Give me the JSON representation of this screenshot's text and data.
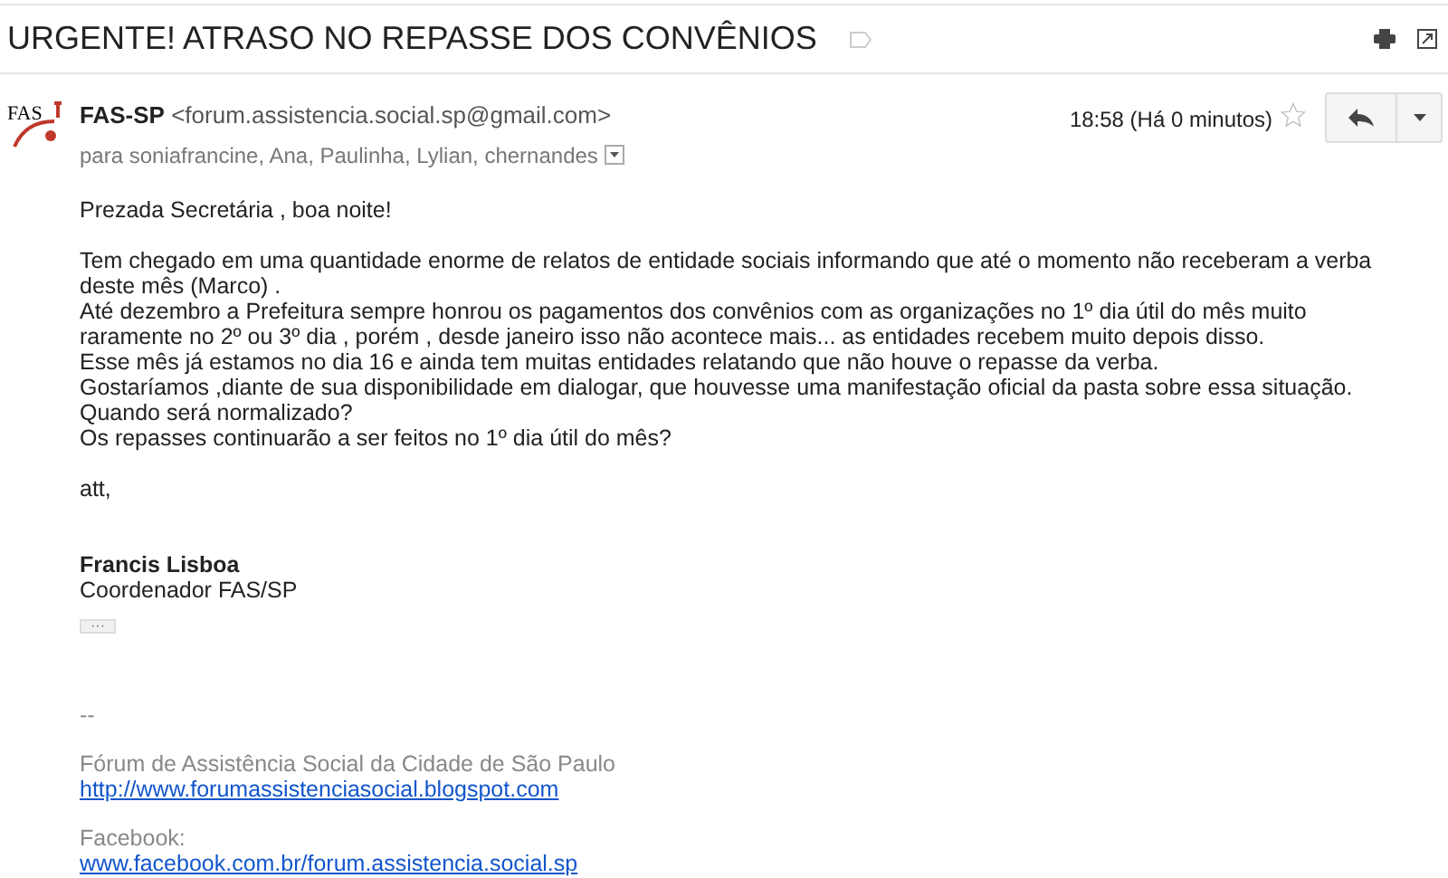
{
  "subject": "URGENTE! ATRASO NO REPASSE DOS CONVÊNIOS",
  "sender": {
    "name": "FAS-SP",
    "email": "<forum.assistencia.social.sp@gmail.com>",
    "avatar_text": "FAS",
    "recipients": "para soniafrancine, Ana, Paulinha, Lylian, chernandes",
    "time": "18:58 (Há 0 minutos)",
    "starred": false
  },
  "body": [
    [
      "Prezada Secretária , boa noite!"
    ],
    [
      "Tem chegado em uma quantidade enorme de relatos de entidade sociais informando que até o momento não receberam a verba deste mês (Marco) .",
      "Até dezembro a Prefeitura sempre honrou os pagamentos dos convênios com as organizações no 1º dia útil do mês muito raramente no 2º ou 3º dia , porém , desde janeiro isso não acontece mais... as entidades recebem muito depois disso.",
      "Esse mês já estamos no dia 16 e ainda tem muitas entidades relatando que não houve o repasse da verba.",
      "Gostaríamos ,diante de sua disponibilidade em dialogar, que houvesse uma manifestação oficial da pasta sobre essa situação.",
      "Quando será normalizado?",
      "Os repasses continuarão a ser feitos no 1º dia útil do mês?"
    ],
    [
      "att,"
    ]
  ],
  "signature": {
    "name": "Francis Lisboa",
    "role": "Coordenador FAS/SP",
    "expand": "···"
  },
  "footer": [
    {
      "kind": "text",
      "text": "--"
    },
    {
      "kind": "gap"
    },
    {
      "kind": "text",
      "text": "Fórum de Assistência Social da Cidade de São Paulo"
    },
    {
      "kind": "link",
      "text": "http://www.forumassistenciasocial.blogspot.com"
    },
    {
      "kind": "gap"
    },
    {
      "kind": "text",
      "text": "Facebook:"
    },
    {
      "kind": "link",
      "text": "www.facebook.com.br/forum.assistencia.social.sp"
    }
  ]
}
